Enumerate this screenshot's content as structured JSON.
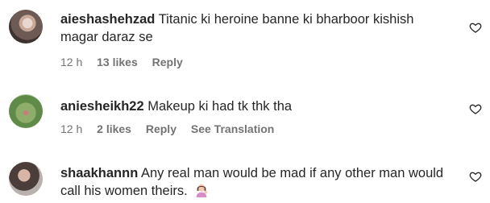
{
  "comments": [
    {
      "username": "aieshashehzad",
      "text": "Titanic ki heroine banne ki bharboor kishish magar daraz se",
      "time": "12 h",
      "likes": "13 likes",
      "reply": "Reply"
    },
    {
      "username": "aniesheikh22",
      "text": "Makeup ki had tk thk tha",
      "time": "12 h",
      "likes": "2 likes",
      "reply": "Reply",
      "translate": "See Translation"
    },
    {
      "username": "shaakhannn",
      "text": "Any real man would be mad if any other man would call his women theirs.",
      "emoji_icon": "woman-tipping-hand-emoji"
    }
  ]
}
